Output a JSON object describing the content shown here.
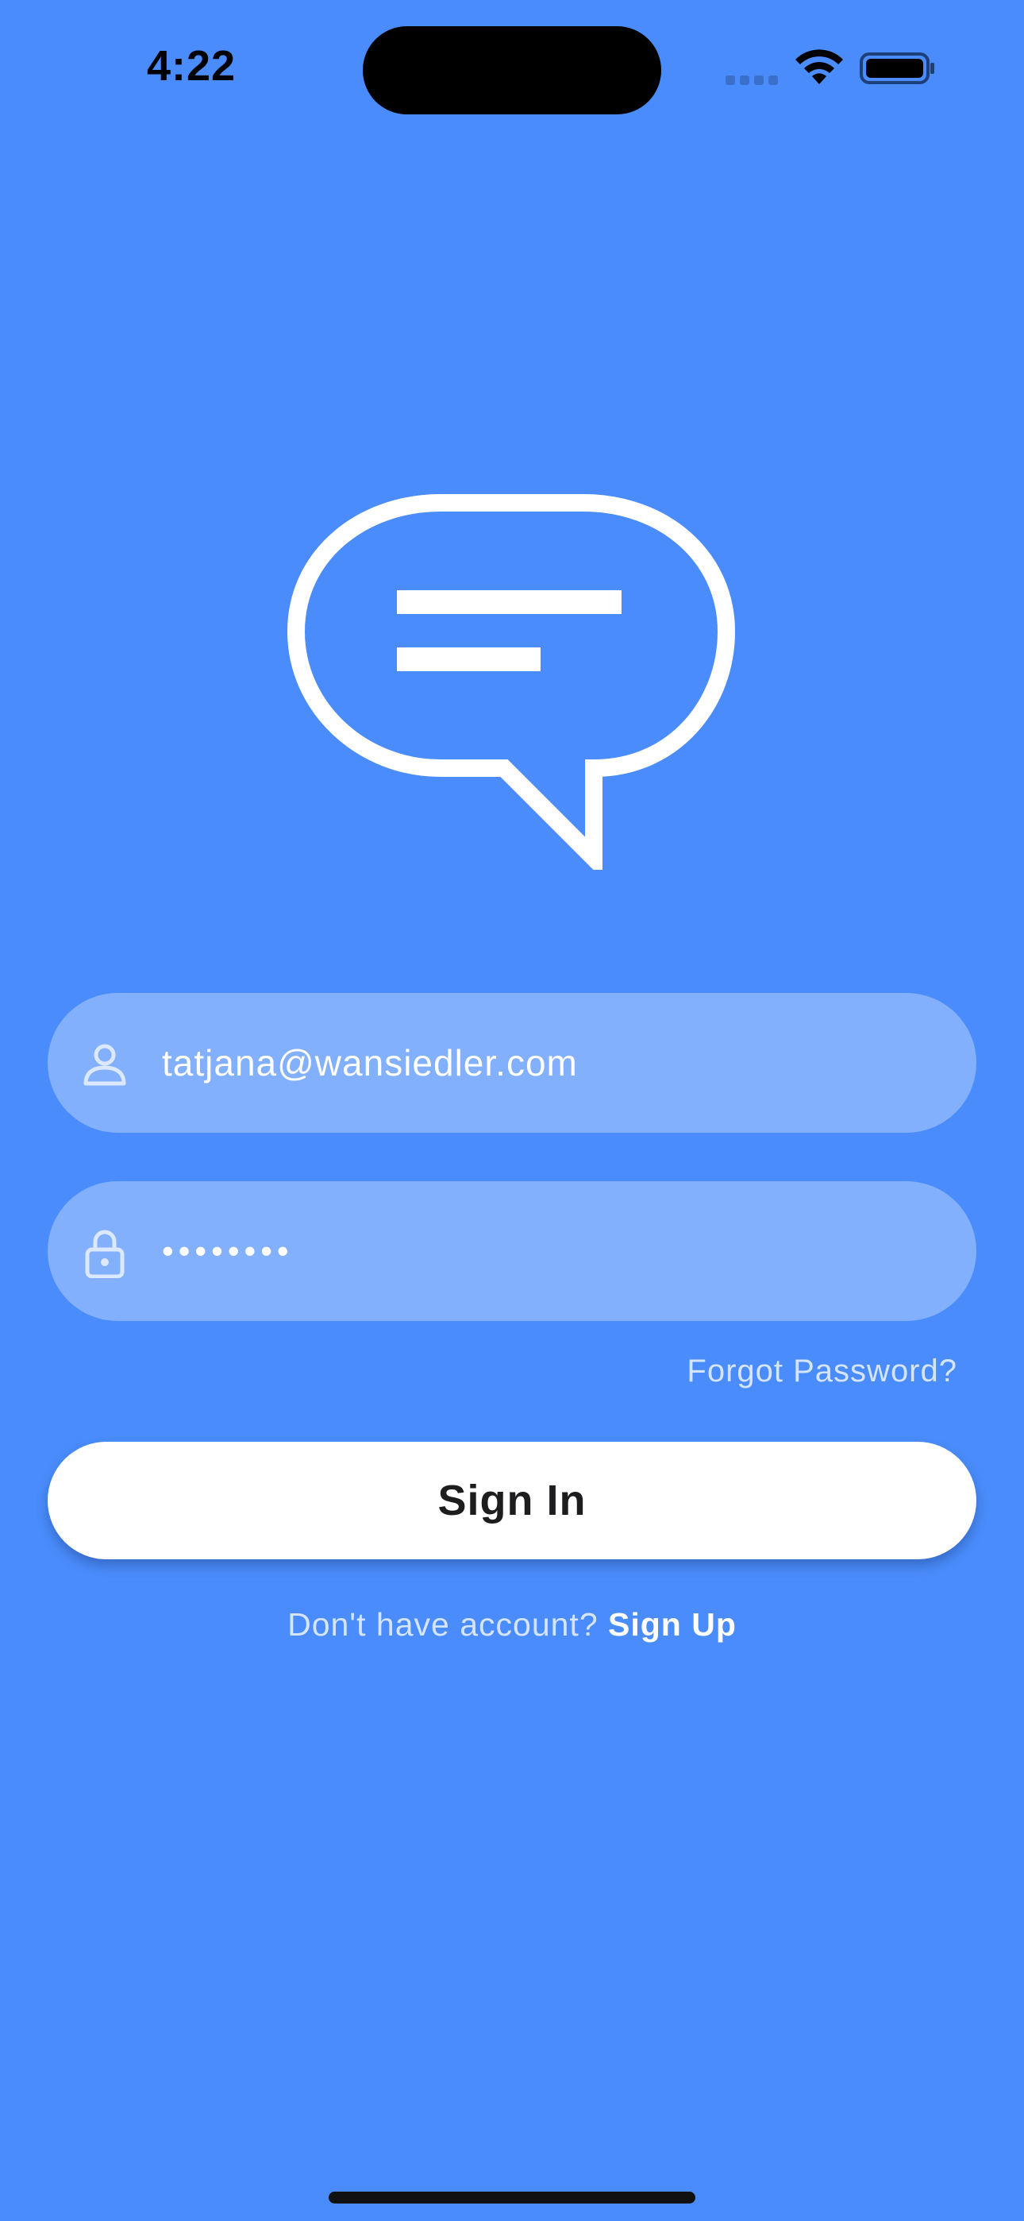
{
  "status_bar": {
    "time": "4:22"
  },
  "login": {
    "email": {
      "value": "tatjana@wansiedler.com",
      "icon": "person-icon"
    },
    "password": {
      "value": "••••••••",
      "icon": "lock-icon"
    },
    "forgot_password_label": "Forgot Password?",
    "sign_in_label": "Sign In",
    "no_account_text": "Don't have account?",
    "sign_up_label": "Sign Up"
  },
  "colors": {
    "background": "#4a8cfb",
    "field_background": "#83b0fc",
    "button_background": "#ffffff",
    "muted_text": "#d6e5ff"
  }
}
